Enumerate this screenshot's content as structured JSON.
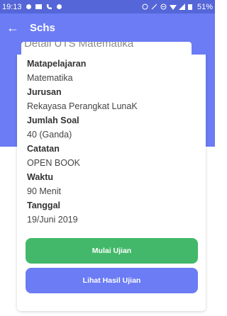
{
  "statusbar": {
    "time": "19:13",
    "battery": "51%"
  },
  "appbar": {
    "title": "Schs",
    "back_icon": "arrow-left-icon"
  },
  "card": {
    "title": "Detail UTS Matematika",
    "fields": [
      {
        "label": "Matapelajaran",
        "value": "Matematika"
      },
      {
        "label": "Jurusan",
        "value": "Rekayasa Perangkat LunaK"
      },
      {
        "label": "Jumlah Soal",
        "value": "40 (Ganda)"
      },
      {
        "label": "Catatan",
        "value": "OPEN BOOK"
      },
      {
        "label": "Waktu",
        "value": "90 Menit"
      },
      {
        "label": "Tanggal",
        "value": "19/Juni 2019"
      }
    ]
  },
  "buttons": {
    "start_label": "Mulai Ujian",
    "result_label": "Lihat Hasil Ujian"
  },
  "colors": {
    "primary": "#6b7cf4",
    "statusbar": "#5566d8",
    "success": "#43b86a"
  }
}
